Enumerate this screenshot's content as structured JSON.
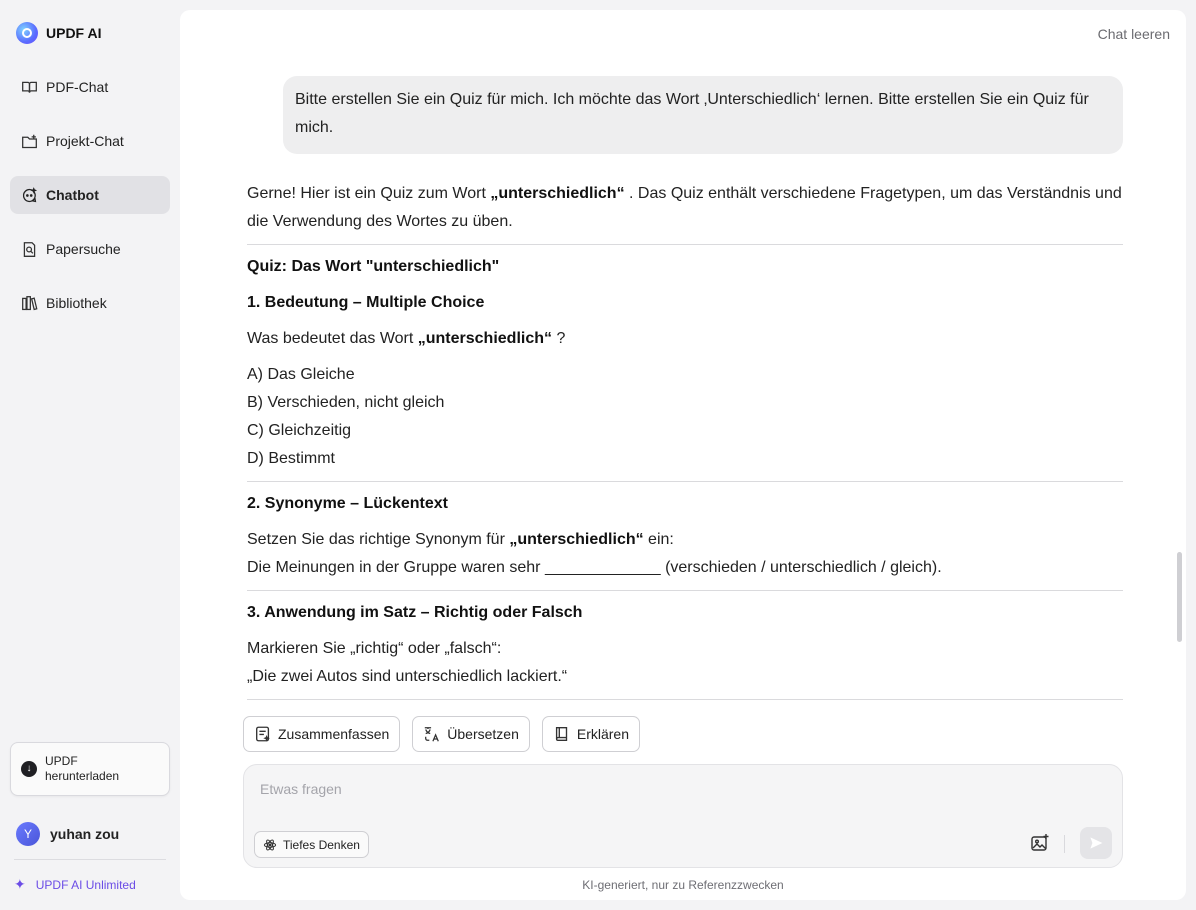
{
  "brand": {
    "name": "UPDF AI"
  },
  "sidebar": {
    "items": [
      {
        "label": "PDF-Chat",
        "icon": "book-open-icon",
        "active": false
      },
      {
        "label": "Projekt-Chat",
        "icon": "folder-plus-icon",
        "active": false
      },
      {
        "label": "Chatbot",
        "icon": "chatbot-icon",
        "active": true
      },
      {
        "label": "Papersuche",
        "icon": "document-search-icon",
        "active": false
      },
      {
        "label": "Bibliothek",
        "icon": "library-icon",
        "active": false
      }
    ],
    "download": {
      "line1": "UPDF",
      "line2": "herunterladen"
    },
    "user": {
      "initial": "Y",
      "name": "yuhan zou"
    },
    "unlimited": "UPDF AI Unlimited"
  },
  "header": {
    "clear_chat": "Chat leeren"
  },
  "chat": {
    "user_message": "Bitte erstellen Sie ein Quiz für mich. Ich möchte das Wort ‚Unterschiedlich‘ lernen. Bitte erstellen Sie ein Quiz für mich.",
    "answer": {
      "intro_pre": "Gerne! Hier ist ein Quiz zum Wort ",
      "intro_word": "„unterschiedlich“",
      "intro_post": " . Das Quiz enthält verschiedene Fragetypen, um das Verständnis und die Verwendung des Wortes zu üben.",
      "quiz_title": "Quiz: Das Wort \"unterschiedlich\"",
      "q1_title": "1. Bedeutung – Multiple Choice",
      "q1_pre": "Was bedeutet das Wort ",
      "q1_word": "„unterschiedlich“",
      "q1_post": " ?",
      "q1_options": [
        "A) Das Gleiche",
        "B) Verschieden, nicht gleich",
        "C) Gleichzeitig",
        "D) Bestimmt"
      ],
      "q2_title": "2. Synonyme – Lückentext",
      "q2_pre": "Setzen Sie das richtige Synonym für ",
      "q2_word": "„unterschiedlich“",
      "q2_post": " ein:",
      "q2_sentence": "Die Meinungen in der Gruppe waren sehr _____________ (verschieden / unterschiedlich / gleich).",
      "q3_title": "3. Anwendung im Satz – Richtig oder Falsch",
      "q3_instruction": "Markieren Sie „richtig“ oder „falsch“:",
      "q3_sentence": "„Die zwei Autos sind unterschiedlich lackiert.“"
    }
  },
  "actions": [
    {
      "label": "Zusammenfassen",
      "icon": "summarize-icon"
    },
    {
      "label": "Übersetzen",
      "icon": "translate-icon"
    },
    {
      "label": "Erklären",
      "icon": "book-icon"
    }
  ],
  "composer": {
    "placeholder": "Etwas fragen",
    "value": "",
    "deep_think": "Tiefes Denken"
  },
  "footer": {
    "note": "KI-generiert, nur zu Referenzzwecken"
  }
}
